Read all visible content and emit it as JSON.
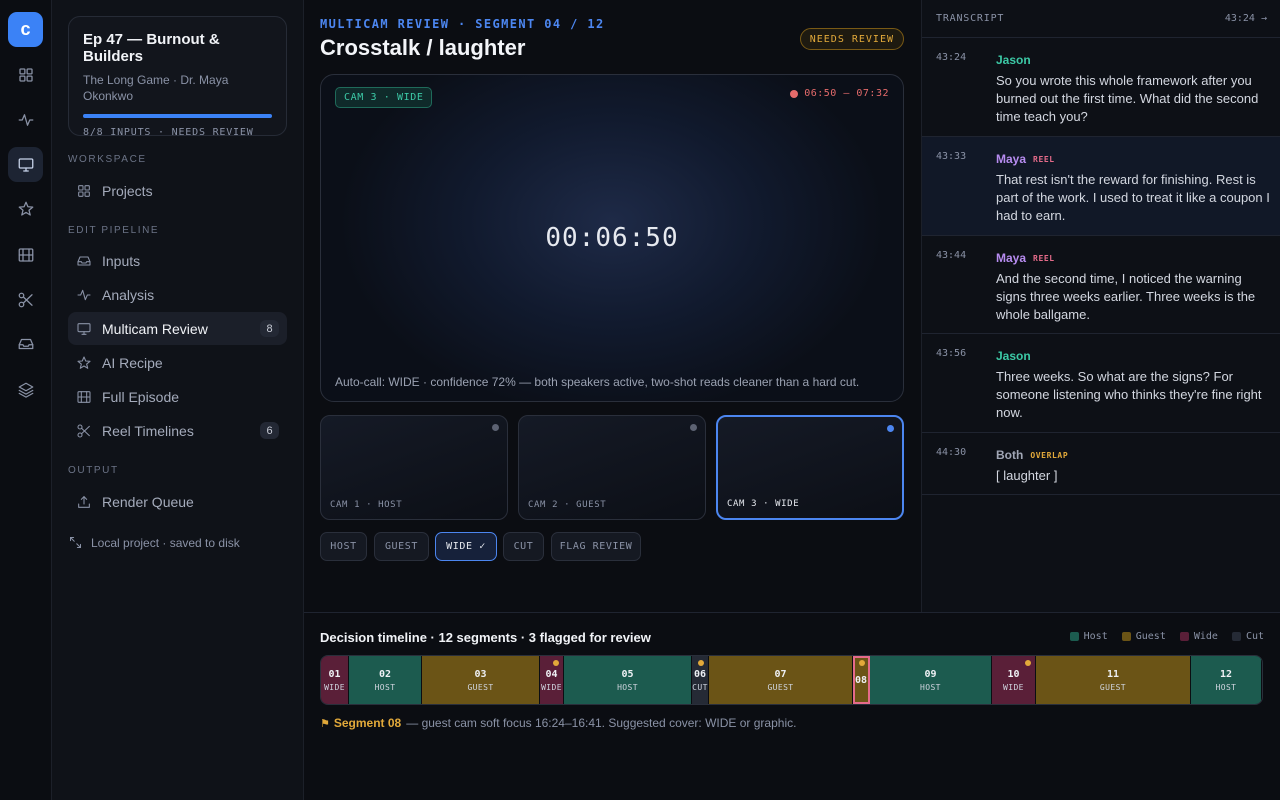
{
  "rail": {
    "logo": "c",
    "items": [
      "dashboard-icon",
      "pulse-icon",
      "monitor-icon",
      "star-icon",
      "film-icon",
      "scissors-icon",
      "inbox-icon",
      "layers-icon"
    ],
    "active": "monitor-icon"
  },
  "episode": {
    "title": "Ep 47 — Burnout & Builders",
    "subtitle": "The Long Game · Dr. Maya Okonkwo",
    "progress": 1.0,
    "meta": "8/8 INPUTS · NEEDS REVIEW"
  },
  "sidebar": {
    "workspace_label": "WORKSPACE",
    "projects": "Projects",
    "pipeline_label": "EDIT PIPELINE",
    "inputs": "Inputs",
    "analysis": "Analysis",
    "multicam": "Multicam Review",
    "multicam_count": "8",
    "recipe": "AI Recipe",
    "full": "Full Episode",
    "reels": "Reel Timelines",
    "reels_count": "6",
    "output_label": "OUTPUT",
    "render": "Render Queue",
    "local": "Local project · saved to disk"
  },
  "main": {
    "kicker": "MULTICAM REVIEW · SEGMENT 04 / 12",
    "title": "Crosstalk / laughter",
    "status": "NEEDS REVIEW",
    "viewer": {
      "cam": "CAM 3 · WIDE",
      "range": "06:50 – 07:32",
      "timecode": "00:06:50",
      "autocall": "Auto-call: WIDE · confidence 72% — both speakers active, two-shot reads cleaner than a hard cut."
    },
    "thumbs": [
      "CAM 1 · HOST",
      "CAM 2 · GUEST",
      "CAM 3 · WIDE"
    ],
    "buttons": {
      "host": "HOST",
      "guest": "GUEST",
      "wide": "WIDE ✓",
      "cut": "CUT",
      "flag": "FLAG REVIEW"
    }
  },
  "transcript": {
    "label": "TRANSCRIPT",
    "time": "43:24 →",
    "entries": [
      {
        "ts": "43:24",
        "speaker": "Jason",
        "tag": "",
        "text": "So you wrote this whole framework after you burned out the first time. What did the second time teach you?"
      },
      {
        "ts": "43:33",
        "speaker": "Maya",
        "tag": "REEL",
        "text": "That rest isn't the reward for finishing. Rest is part of the work. I used to treat it like a coupon I had to earn."
      },
      {
        "ts": "43:44",
        "speaker": "Maya",
        "tag": "REEL",
        "text": "And the second time, I noticed the warning signs three weeks earlier. Three weeks is the whole ballgame."
      },
      {
        "ts": "43:56",
        "speaker": "Jason",
        "tag": "",
        "text": "Three weeks. So what are the signs? For someone listening who thinks they're fine right now."
      },
      {
        "ts": "44:30",
        "speaker": "Both",
        "tag": "OVERLAP",
        "text": "[ laughter ]"
      }
    ]
  },
  "timeline": {
    "title": "Decision timeline · 12 segments · 3 flagged for review",
    "legend": {
      "host": "Host",
      "guest": "Guest",
      "wide": "Wide",
      "cut": "Cut"
    },
    "colors": {
      "host": "#1c5b4f",
      "guest": "#6b5416",
      "wide": "#5a1f38",
      "cut": "#252a35"
    },
    "segments": [
      {
        "n": "01",
        "k": "WIDE",
        "type": "wide",
        "w": 28,
        "flag": false
      },
      {
        "n": "02",
        "k": "HOST",
        "type": "host",
        "w": 73,
        "flag": false
      },
      {
        "n": "03",
        "k": "GUEST",
        "type": "guest",
        "w": 118,
        "flag": false
      },
      {
        "n": "04",
        "k": "WIDE",
        "type": "wide",
        "w": 24,
        "flag": true
      },
      {
        "n": "05",
        "k": "HOST",
        "type": "host",
        "w": 128,
        "flag": false
      },
      {
        "n": "06",
        "k": "CUT",
        "type": "cut",
        "w": 17,
        "flag": true
      },
      {
        "n": "07",
        "k": "GUEST",
        "type": "guest",
        "w": 144,
        "flag": false
      },
      {
        "n": "08",
        "k": "",
        "type": "guest",
        "w": 17,
        "flag": true,
        "hl": true
      },
      {
        "n": "09",
        "k": "HOST",
        "type": "host",
        "w": 122,
        "flag": false
      },
      {
        "n": "10",
        "k": "WIDE",
        "type": "wide",
        "w": 44,
        "flag": true
      },
      {
        "n": "11",
        "k": "GUEST",
        "type": "guest",
        "w": 155,
        "flag": false
      },
      {
        "n": "12",
        "k": "HOST",
        "type": "host",
        "w": 71,
        "flag": false
      }
    ],
    "note_bold": "Segment 08",
    "note_text": "— guest cam soft focus 16:24–16:41. Suggested cover: WIDE or graphic."
  }
}
